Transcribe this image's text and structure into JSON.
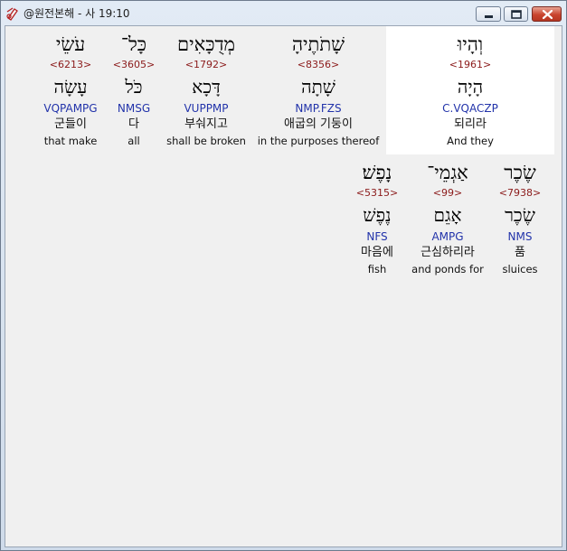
{
  "window": {
    "title": "@원전본해 - 사 19:10",
    "close_color": "#c9452f"
  },
  "words": [
    {
      "row": 1,
      "highlighted": true,
      "hebrew": "וְהָיוּ",
      "strong": "<1961>",
      "lemma": "הָיָה",
      "morph": "C.VQACZP",
      "korean": "되리라",
      "english": "And they"
    },
    {
      "row": 1,
      "highlighted": false,
      "hebrew": "שָׁתֹתֶיהָ",
      "strong": "<8356>",
      "lemma": "שָׁתָה",
      "morph": "NMP.FZS",
      "korean": "애굽의 기둥이",
      "english": "in the purposes thereof"
    },
    {
      "row": 1,
      "highlighted": false,
      "hebrew": "מְדֻכָּאִים",
      "strong": "<1792>",
      "lemma": "דָּכָא",
      "morph": "VUPPMP",
      "korean": "부숴지고",
      "english": "shall be broken"
    },
    {
      "row": 1,
      "highlighted": false,
      "hebrew": "כָּל־",
      "strong": "<3605>",
      "lemma": "כֹּל",
      "morph": "NMSG",
      "korean": "다",
      "english": "all"
    },
    {
      "row": 1,
      "highlighted": false,
      "hebrew": "עֹשֵׂי",
      "strong": "<6213>",
      "lemma": "עָשָׂה",
      "morph": "VQPAMPG",
      "korean": "군들이",
      "english": "that make"
    },
    {
      "row": 2,
      "highlighted": false,
      "hebrew": "שֶׂכֶר",
      "strong": "<7938>",
      "lemma": "שֶׂכֶר",
      "morph": "NMS",
      "korean": "품",
      "english": "sluices"
    },
    {
      "row": 2,
      "highlighted": false,
      "hebrew": "אַגְמֵי־",
      "strong": "<99>",
      "lemma": "אָגֵם",
      "morph": "AMPG",
      "korean": "근심하리라",
      "english": "and ponds for"
    },
    {
      "row": 2,
      "highlighted": false,
      "hebrew": "נָפֶשׁ׃",
      "strong": "<5315>",
      "lemma": "נֶפֶשׁ",
      "morph": "NFS",
      "korean": "마음에",
      "english": "fish"
    }
  ]
}
